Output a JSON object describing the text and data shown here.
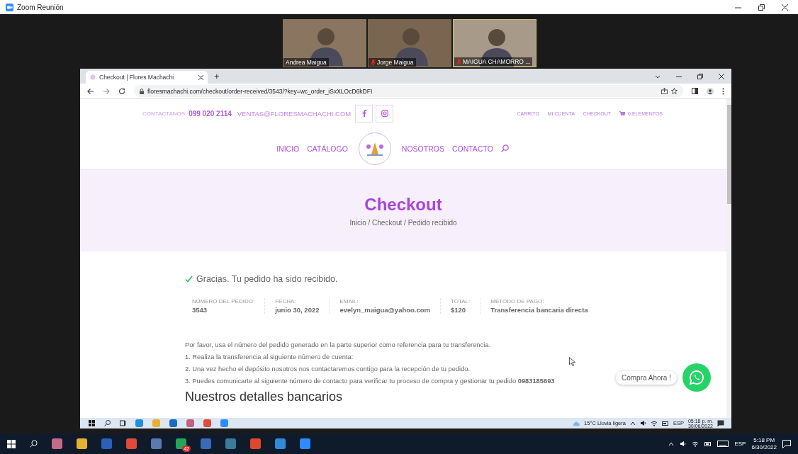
{
  "zoom": {
    "title": "Zoom Reunión"
  },
  "participants": [
    {
      "name": "Andrea Maigua",
      "muted": false
    },
    {
      "name": "Jorge Maigua",
      "muted": true
    },
    {
      "name": "MAIGUA CHAMORRO ...",
      "muted": true
    }
  ],
  "browser": {
    "tab_title": "Checkout | Flores Machachi",
    "new_tab": "+",
    "url": "floresmachachi.com/checkout/order-received/3543/?key=wc_order_iSxXLOcD6kDFI"
  },
  "site": {
    "contact_label": "CONTACTANOS",
    "phone": "099 020 2114",
    "email": "VENTAS@FLORESMACHACHI.COM",
    "top_links": [
      "CARRITO",
      "MI CUENTA",
      "CHECKOUT"
    ],
    "cart": "0 ELEMENTOS",
    "nav_left": [
      "INICIO",
      "CATÁLOGO"
    ],
    "nav_right": [
      "NOSOTROS",
      "CONTACTO"
    ]
  },
  "hero": {
    "title": "Checkout",
    "breadcrumb": "Inicio / Checkout / Pedido recibido"
  },
  "notice": "Gracias. Tu pedido ha sido recibido.",
  "order_details": [
    {
      "label": "NÚMERO DEL PEDIDO:",
      "value": "3543"
    },
    {
      "label": "FECHA:",
      "value": "junio 30, 2022"
    },
    {
      "label": "EMAIL:",
      "value": "evelyn_maigua@yahoo.com"
    },
    {
      "label": "TOTAL:",
      "value": "$120"
    },
    {
      "label": "MÉTODO DE PAGO:",
      "value": "Transferencia bancaria directa"
    }
  ],
  "instructions": [
    "Por favor, usa el número del pedido generado en la parte superior como referencia para tu transferencia.",
    "1. Realiza la transferencia al siguiente número de cuenta:",
    "2. Una vez hecho el depósito nosotros nos contactaremos contigo para la recepción de tu pedido.",
    "3. Puedes comunicarte al siguiente número de contacto para verificar tu proceso de compra y gestionar tu pedido **0983185693**"
  ],
  "bank_heading": "Nuestros detalles bancarios",
  "whatsapp": {
    "label": "Compra Ahora !"
  },
  "inner_taskbar": {
    "weather": "15°C Lluvia ligera",
    "language": "ESP",
    "time": "05:18 p. m.",
    "date": "30/06/2022"
  },
  "taskbar": {
    "badge": "42",
    "language": "ESP",
    "time": "5:18 PM",
    "date": "6/30/2022"
  }
}
